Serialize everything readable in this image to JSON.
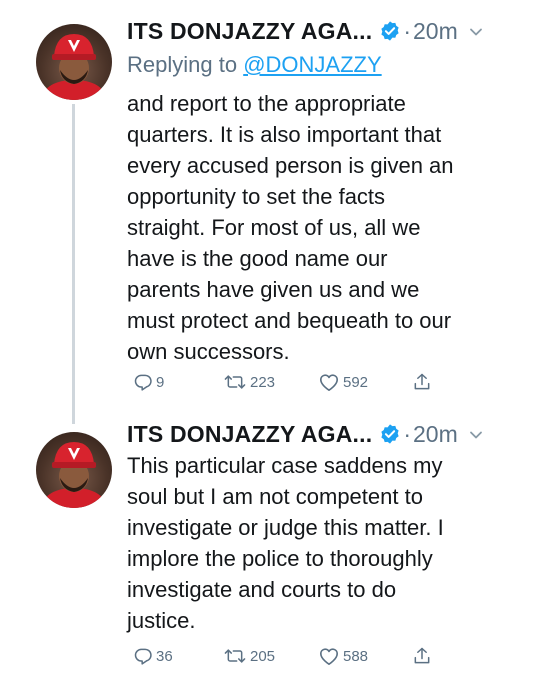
{
  "tweets": [
    {
      "display_name": "ITS DONJAZZY AGA...",
      "time": "20m",
      "replying_prefix": "Replying to",
      "replying_handle": "@DONJAZZY",
      "body_lines": [
        "and report to the appropriate",
        "quarters. It is also important that",
        "every accused person is given an",
        "opportunity to set the facts",
        "straight. For most of us, all we",
        "have is the good name our",
        "parents have given us and we",
        "must protect and bequeath to our",
        "own successors."
      ],
      "reply_count": "9",
      "retweet_count": "223",
      "like_count": "592"
    },
    {
      "display_name": "ITS DONJAZZY AGA...",
      "time": "20m",
      "body_lines": [
        "This particular case saddens my",
        "soul but I am not competent to",
        "investigate or judge this matter. I",
        "implore the police to thoroughly",
        "investigate and courts to do",
        "justice."
      ],
      "reply_count": "36",
      "retweet_count": "205",
      "like_count": "588"
    }
  ],
  "icons": {
    "avatar": "avatar-photo",
    "verified": "verified-badge-icon",
    "more": "chevron-down-icon",
    "reply": "reply-icon",
    "retweet": "retweet-icon",
    "like": "heart-icon",
    "share": "share-icon"
  },
  "colors": {
    "verified": "#1da1f2",
    "muted": "#5b7083",
    "link": "#1da1f2",
    "thread_line": "#cfd6dc"
  }
}
